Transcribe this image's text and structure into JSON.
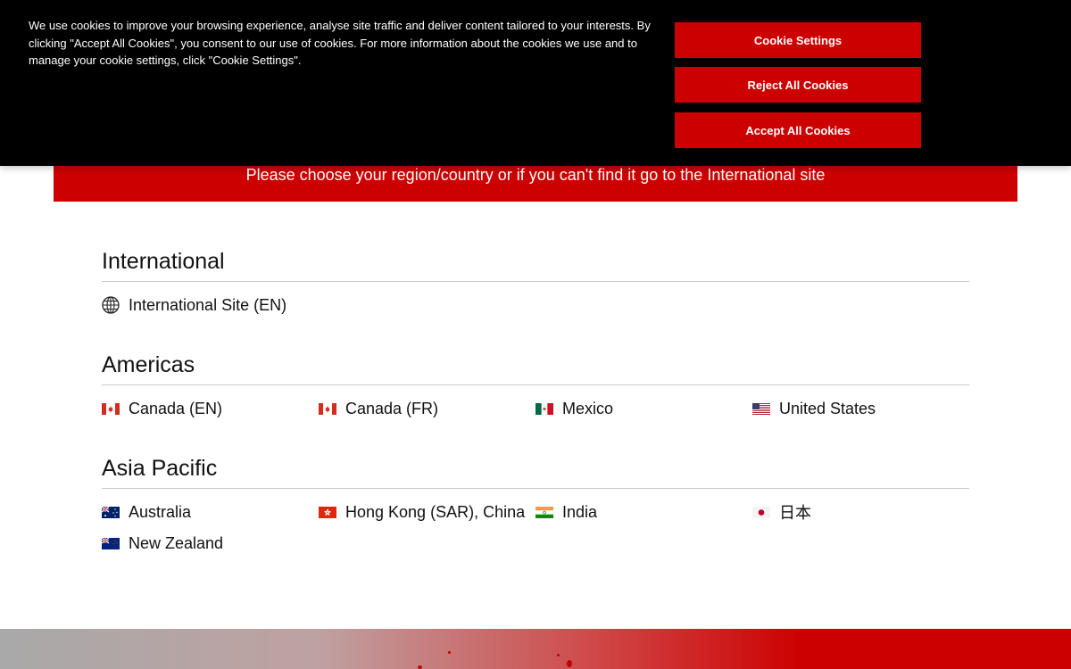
{
  "cookie": {
    "text": "We use cookies to improve your browsing experience, analyse site traffic and deliver content tailored to your interests. By clicking \"Accept All Cookies\", you consent to our use of cookies. For more information about the cookies we use and to manage your cookie settings, click \"Cookie Settings\".",
    "settings_label": "Cookie Settings",
    "reject_label": "Reject All Cookies",
    "accept_label": "Accept All Cookies"
  },
  "banner": {
    "text": "Please choose your region/country or if you can't find it go to the International site"
  },
  "sections": {
    "international": {
      "title": "International",
      "items": [
        {
          "label": "International Site (EN)",
          "icon": "globe-icon"
        }
      ]
    },
    "americas": {
      "title": "Americas",
      "items": [
        {
          "label": "Canada (EN)",
          "icon": "canada-flag-icon"
        },
        {
          "label": "Canada (FR)",
          "icon": "canada-flag-icon"
        },
        {
          "label": "Mexico",
          "icon": "mexico-flag-icon"
        },
        {
          "label": "United States",
          "icon": "usa-flag-icon"
        }
      ]
    },
    "asia_pacific": {
      "title": "Asia Pacific",
      "items": [
        {
          "label": "Australia",
          "icon": "australia-flag-icon"
        },
        {
          "label": "Hong Kong (SAR), China",
          "icon": "hong-kong-flag-icon"
        },
        {
          "label": "India",
          "icon": "india-flag-icon"
        },
        {
          "label": "日本",
          "icon": "japan-flag-icon"
        },
        {
          "label": "New Zealand",
          "icon": "new-zealand-flag-icon"
        }
      ]
    }
  },
  "colors": {
    "brand_red": "#cc0000",
    "cookie_bg": "#000000",
    "divider": "#c9c9c9"
  }
}
